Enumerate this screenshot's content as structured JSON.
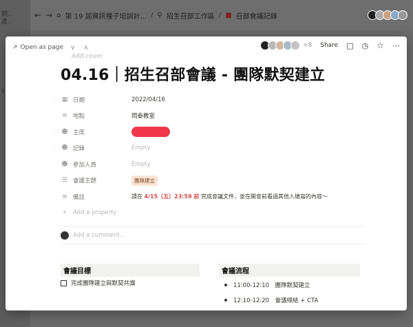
{
  "background": {
    "sidebar_text_1": "類...",
    "sidebar_text_2": "產...",
    "sidebar_text_3": "lt",
    "breadcrumb": [
      {
        "icon": "home-icon",
        "label": "第 19 屆資訊種子培訓計..."
      },
      {
        "icon": "search-icon",
        "label": "招生召部工作區"
      },
      {
        "icon": "bookmark-icon",
        "label": "召部會議記錄"
      }
    ]
  },
  "modal": {
    "open_as_page": "Open as page",
    "extra_viewers": "+8",
    "share_label": "Share",
    "add_cover": "Add cover",
    "title": "04.16｜招生召部會議 - 團隊默契建立",
    "properties": [
      {
        "icon": "calendar-icon",
        "label": "日期",
        "value": "2022/04/16",
        "type": "text"
      },
      {
        "icon": "text-icon",
        "label": "地點",
        "value": "岡泰教室",
        "type": "text"
      },
      {
        "icon": "person-icon",
        "label": "主席",
        "value": "",
        "type": "redacted"
      },
      {
        "icon": "person-icon",
        "label": "記錄",
        "value": "Empty",
        "type": "empty"
      },
      {
        "icon": "people-icon",
        "label": "參加人員",
        "value": "Empty",
        "type": "empty"
      },
      {
        "icon": "list-icon",
        "label": "會議主題",
        "value": "團隊建立",
        "type": "tag"
      },
      {
        "icon": "text-icon",
        "label": "備註",
        "type": "remark",
        "remark_prefix": "請在 ",
        "remark_highlight": "4/15（五）23:59 前",
        "remark_suffix": " 完成會議文件，並在開會前看過其他人填寫的內容～"
      }
    ],
    "add_property": "Add a property",
    "comment_placeholder": "Add a comment...",
    "goals_heading": "會議目標",
    "goal_item": "完成團隊建立與默契共識",
    "flow_heading": "會議流程",
    "flow_items": [
      "11:00-12:10　團隊默契建立",
      "12:10-12:20　會議總結 + CTA"
    ]
  },
  "colors": {
    "accent_red": "#d44c47",
    "tag_bg": "#fbe3d4",
    "redact": "#f0384a"
  }
}
